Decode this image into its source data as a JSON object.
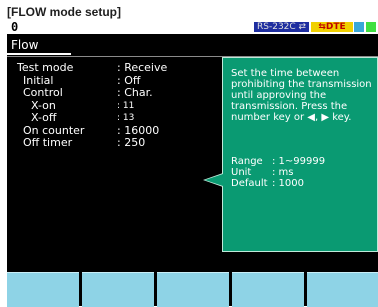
{
  "caption": "[FLOW mode setup]",
  "statusbar": {
    "left_value": "0",
    "rs_label": "RS-232C ⇄",
    "dte_label": "⇆DTE"
  },
  "tab": {
    "label": "Flow"
  },
  "settings": [
    {
      "label": "Test mode",
      "value": ": Receive"
    },
    {
      "label": "Initial",
      "value": ": Off"
    },
    {
      "label": "Control",
      "value": ": Char."
    },
    {
      "label": "X-on",
      "value": ": 11"
    },
    {
      "label": "X-off",
      "value": ": 13"
    },
    {
      "label": "On counter",
      "value": ":   16000"
    },
    {
      "label": "Off timer",
      "value": ":     250"
    }
  ],
  "help": {
    "text": "Set the time between prohibiting the transmission until approving the transmission. Press the number key or ◀, ▶ key.",
    "range_label": "Range",
    "range_value": ": 1~99999",
    "unit_label": "Unit",
    "unit_value": ": ms",
    "default_label": "Default",
    "default_value": ": 1000"
  },
  "function_keys": [
    "",
    "",
    "",
    "",
    ""
  ]
}
